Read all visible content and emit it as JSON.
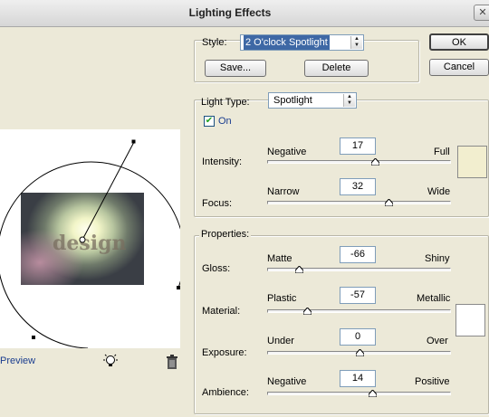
{
  "window": {
    "title": "Lighting Effects"
  },
  "style": {
    "label": "Style:",
    "value": "2 O'clock Spotlight",
    "save_label": "Save...",
    "delete_label": "Delete"
  },
  "buttons": {
    "ok_label": "OK",
    "cancel_label": "Cancel"
  },
  "light_type": {
    "label": "Light Type:",
    "value": "Spotlight",
    "on_label": "On",
    "on_checked": true
  },
  "intensity": {
    "label": "Intensity:",
    "min_label": "Negative",
    "max_label": "Full",
    "value": "17",
    "level": 0.585
  },
  "focus": {
    "label": "Focus:",
    "min_label": "Narrow",
    "max_label": "Wide",
    "value": "32",
    "level": 0.66
  },
  "light_color": "#f2eecf",
  "properties": {
    "title": "Properties:",
    "gloss": {
      "label": "Gloss:",
      "min_label": "Matte",
      "max_label": "Shiny",
      "value": "-66",
      "level": 0.17
    },
    "material": {
      "label": "Material:",
      "min_label": "Plastic",
      "max_label": "Metallic",
      "value": "-57",
      "level": 0.215
    },
    "exposure": {
      "label": "Exposure:",
      "min_label": "Under",
      "max_label": "Over",
      "value": "0",
      "level": 0.5
    },
    "ambience": {
      "label": "Ambience:",
      "min_label": "Negative",
      "max_label": "Positive",
      "value": "14",
      "level": 0.57
    },
    "ambient_color": "#ffffff"
  },
  "preview": {
    "checkbox_label": "Preview",
    "image_text": "design",
    "light_bulb_icon": "light-bulb-icon",
    "trash_icon": "trash-icon"
  }
}
